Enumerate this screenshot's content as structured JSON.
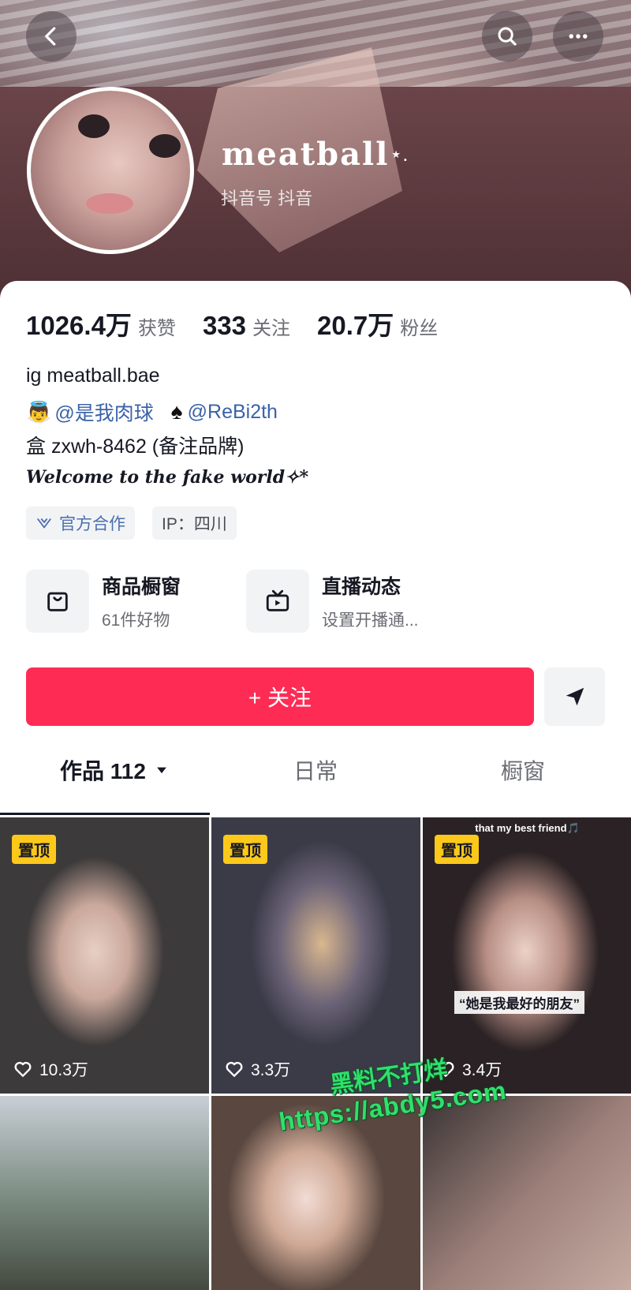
{
  "header": {
    "username": "meatball",
    "username_deco": "⋆.",
    "douyin_id": "抖音号 抖音"
  },
  "stats": [
    {
      "value": "1026.4万",
      "label": "获赞"
    },
    {
      "value": "333",
      "label": "关注"
    },
    {
      "value": "20.7万",
      "label": "粉丝"
    }
  ],
  "bio": {
    "ig": "ig  meatball.bae",
    "mention_1_emoji": "👼",
    "mention_1": "@是我肉球",
    "mention_2_emoji": "♠",
    "mention_2": "@ReBi2th",
    "box": "盒 zxwh-8462 (备注品牌)",
    "fancy": "Welcome to the fake world✧*"
  },
  "tags": {
    "official": "官方合作",
    "ip": "IP：四川"
  },
  "features": {
    "shop_title": "商品橱窗",
    "shop_sub": "61件好物",
    "live_title": "直播动态",
    "live_sub": "设置开播通..."
  },
  "actions": {
    "follow": "+ 关注"
  },
  "tabs": {
    "works": "作品 112",
    "daily": "日常",
    "shop": "橱窗"
  },
  "videos": [
    {
      "pin": "置顶",
      "likes": "10.3万"
    },
    {
      "pin": "置顶",
      "likes": "3.3万"
    },
    {
      "pin": "置顶",
      "likes": "3.4万",
      "caption_top": "that my best friend🎵",
      "caption_mid": "“她是我最好的朋友”"
    }
  ],
  "watermark": {
    "line1": "黑料不打烊",
    "line2": "https://abdy5.com"
  },
  "colors": {
    "follow": "#fe2c55",
    "mention": "#3a62a8",
    "pin": "#fcc81a"
  }
}
